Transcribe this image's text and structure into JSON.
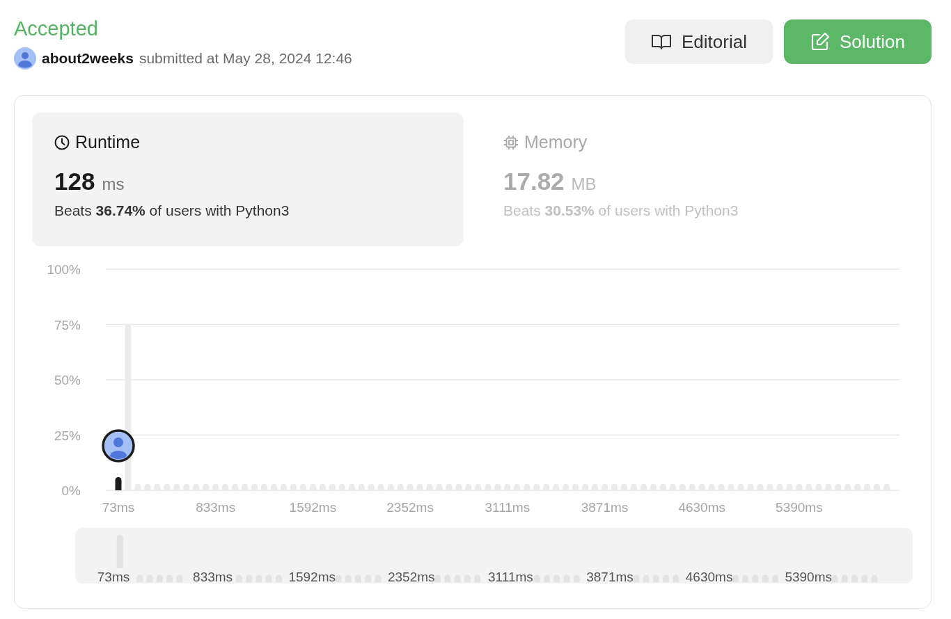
{
  "status": "Accepted",
  "submission": {
    "user": "about2weeks",
    "text": "submitted at May 28, 2024 12:46"
  },
  "buttons": [
    {
      "kind": "editorial",
      "label": "Editorial"
    },
    {
      "kind": "solution",
      "label": "Solution"
    }
  ],
  "metrics": [
    {
      "kind": "runtime",
      "label": "Runtime",
      "value": "128",
      "unit": "ms",
      "beats": "Beats **36.74%** of users with Python3",
      "selected": true
    },
    {
      "kind": "memory",
      "label": "Memory",
      "value": "17.82",
      "unit": "MB",
      "beats": "Beats **30.53%** of users with Python3",
      "selected": false
    }
  ],
  "chart": {
    "chart_data": {
      "type": "bar",
      "ylim": [
        0,
        100
      ],
      "grid": true,
      "yticks": [
        {
          "value": 0,
          "label": "0%"
        },
        {
          "value": 25,
          "label": "25%"
        },
        {
          "value": 50,
          "label": "50%"
        },
        {
          "value": 75,
          "label": "75%"
        },
        {
          "value": 100,
          "label": "100%"
        }
      ],
      "categories": [
        "73ms",
        null,
        null,
        null,
        null,
        null,
        null,
        null,
        null,
        null,
        "833ms",
        null,
        null,
        null,
        null,
        null,
        null,
        null,
        null,
        null,
        "1592ms",
        null,
        null,
        null,
        null,
        null,
        null,
        null,
        null,
        null,
        "2352ms",
        null,
        null,
        null,
        null,
        null,
        null,
        null,
        null,
        null,
        "3111ms",
        null,
        null,
        null,
        null,
        null,
        null,
        null,
        null,
        null,
        "3871ms",
        null,
        null,
        null,
        null,
        null,
        null,
        null,
        null,
        null,
        "4630ms",
        null,
        null,
        null,
        null,
        null,
        null,
        null,
        null,
        null,
        "5390ms",
        null,
        null,
        null,
        null,
        null,
        null,
        null,
        null,
        null
      ],
      "series": [
        {
          "color": "#1c1c1c",
          "values": [
            6,
            null,
            null,
            null,
            null,
            null,
            null,
            null,
            null,
            null,
            null,
            null,
            null,
            null,
            null,
            null,
            null,
            null,
            null,
            null,
            null,
            null,
            null,
            null,
            null,
            null,
            null,
            null,
            null,
            null,
            null,
            null,
            null,
            null,
            null,
            null,
            null,
            null,
            null,
            null,
            null,
            null,
            null,
            null,
            null,
            null,
            null,
            null,
            null,
            null,
            null,
            null,
            null,
            null,
            null,
            null,
            null,
            null,
            null,
            null,
            null,
            null,
            null,
            null,
            null,
            null,
            null,
            null,
            null,
            null,
            null,
            null,
            null,
            null,
            null,
            null,
            null,
            null,
            null,
            null
          ]
        },
        {
          "color": "#ebebeb",
          "values": [
            null,
            75,
            3,
            3,
            3,
            3,
            3,
            3,
            3,
            3,
            3,
            3,
            3,
            3,
            3,
            3,
            3,
            3,
            3,
            3,
            3,
            3,
            3,
            3,
            3,
            3,
            3,
            3,
            3,
            3,
            3,
            3,
            3,
            3,
            3,
            3,
            3,
            3,
            3,
            3,
            3,
            3,
            3,
            3,
            3,
            3,
            3,
            3,
            3,
            3,
            3,
            3,
            3,
            3,
            3,
            3,
            3,
            3,
            3,
            3,
            3,
            3,
            3,
            3,
            3,
            3,
            3,
            3,
            3,
            3,
            3,
            3,
            3,
            3,
            3,
            3,
            3,
            3,
            3,
            3
          ]
        }
      ]
    }
  },
  "overview": {
    "labels": [
      "73ms",
      "833ms",
      "1592ms",
      "2352ms",
      "3111ms",
      "3871ms",
      "4630ms",
      "5390ms"
    ]
  }
}
